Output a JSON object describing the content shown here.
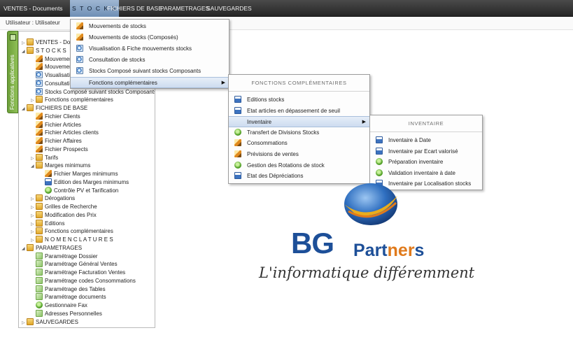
{
  "menubar": {
    "items": [
      {
        "label": "VENTES - Documents"
      },
      {
        "label": "S T O C K S"
      },
      {
        "label": "FICHIERS DE BASE"
      },
      {
        "label": "PARAMETRAGES"
      },
      {
        "label": "SAUVEGARDES"
      }
    ]
  },
  "userbar": {
    "label": "Utilisateur : Utilisateur"
  },
  "sidetab": {
    "label": "Fonctions applicatives"
  },
  "tree": {
    "nodes": [
      {
        "label": "VENTES - Documents",
        "icon": "folder"
      },
      {
        "label": "S T O C K S",
        "icon": "folder"
      },
      {
        "label": "Mouvements de stocks",
        "icon": "pencil"
      },
      {
        "label": "Mouvements de stocks (Composés)",
        "icon": "pencil"
      },
      {
        "label": "Visualisation & Fiche mouvements stocks",
        "icon": "view"
      },
      {
        "label": "Consultation de stocks",
        "icon": "view"
      },
      {
        "label": "Stocks Composé suivant stocks Composants",
        "icon": "view"
      },
      {
        "label": "Fonctions complémentaires",
        "icon": "folder"
      },
      {
        "label": "FICHIERS DE BASE",
        "icon": "folder"
      },
      {
        "label": "Fichier Clients",
        "icon": "pencil"
      },
      {
        "label": "Fichier Articles",
        "icon": "pencil"
      },
      {
        "label": "Fichier Articles clients",
        "icon": "pencil"
      },
      {
        "label": "Fichier Affaires",
        "icon": "pencil"
      },
      {
        "label": "Fichier Prospects",
        "icon": "pencil"
      },
      {
        "label": "Tarifs",
        "icon": "folder"
      },
      {
        "label": "Marges minimums",
        "icon": "folder"
      },
      {
        "label": "Fichier Marges minimums",
        "icon": "pencil"
      },
      {
        "label": "Edition des Marges minimums",
        "icon": "doc"
      },
      {
        "label": "Contrôle PV et Tarification",
        "icon": "green"
      },
      {
        "label": "Dérogations",
        "icon": "folder"
      },
      {
        "label": "Grilles de Recherche",
        "icon": "folder"
      },
      {
        "label": "Modification des Prix",
        "icon": "folder"
      },
      {
        "label": "Editions",
        "icon": "folder"
      },
      {
        "label": "Fonctions complémentaires",
        "icon": "folder"
      },
      {
        "label": "N O M E N C L A T U R E S",
        "icon": "folder"
      },
      {
        "label": "PARAMETRAGES",
        "icon": "folder"
      },
      {
        "label": "Paramétrage Dossier",
        "icon": "check"
      },
      {
        "label": "Paramétrage Général Ventes",
        "icon": "check"
      },
      {
        "label": "Paramétrage Facturation Ventes",
        "icon": "check"
      },
      {
        "label": "Paramétrage codes Consommations",
        "icon": "check"
      },
      {
        "label": "Paramétrage des Tables",
        "icon": "check"
      },
      {
        "label": "Paramétrage documents",
        "icon": "check"
      },
      {
        "label": "Gestionnaire Fax",
        "icon": "green"
      },
      {
        "label": "Adresses Personnelles",
        "icon": "check"
      },
      {
        "label": "SAUVEGARDES",
        "icon": "folder"
      }
    ]
  },
  "menu_stocks": {
    "items": [
      {
        "label": "Mouvements de stocks",
        "icon": "pencil"
      },
      {
        "label": "Mouvements de stocks (Composés)",
        "icon": "pencil"
      },
      {
        "label": "Visualisation & Fiche mouvements stocks",
        "icon": "view"
      },
      {
        "label": "Consultation de stocks",
        "icon": "view"
      },
      {
        "label": "Stocks Composé suivant stocks Composants",
        "icon": "view"
      },
      {
        "label": "Fonctions complémentaires",
        "icon": ""
      }
    ]
  },
  "menu_fonctions": {
    "header": "FONCTIONS COMPLÉMENTAIRES",
    "items": [
      {
        "label": "Editions stocks",
        "icon": "doc"
      },
      {
        "label": "Etat articles en dépassement de seuil",
        "icon": "doc"
      },
      {
        "label": "Inventaire",
        "icon": ""
      },
      {
        "label": "Transfert de Divisions Stocks",
        "icon": "green"
      },
      {
        "label": "Consommations",
        "icon": "pencil"
      },
      {
        "label": "Prévisions de ventes",
        "icon": "pencil"
      },
      {
        "label": "Gestion des Rotations de stock",
        "icon": "green"
      },
      {
        "label": "Etat des Dépréciations",
        "icon": "doc"
      }
    ]
  },
  "menu_inventaire": {
    "header": "INVENTAIRE",
    "items": [
      {
        "label": "Inventaire à Date",
        "icon": "doc"
      },
      {
        "label": "Inventaire par Ecart valorisé",
        "icon": "doc"
      },
      {
        "label": "Préparation inventaire",
        "icon": "green"
      },
      {
        "label": "Validation inventaire à date",
        "icon": "green"
      },
      {
        "label": "Inventaire par Localisation stocks",
        "icon": "doc"
      }
    ]
  },
  "logo": {
    "bg": "BG",
    "partners_a": "Part",
    "partners_b": "ner",
    "partners_c": "s",
    "tagline": "L'informatique différemment"
  }
}
